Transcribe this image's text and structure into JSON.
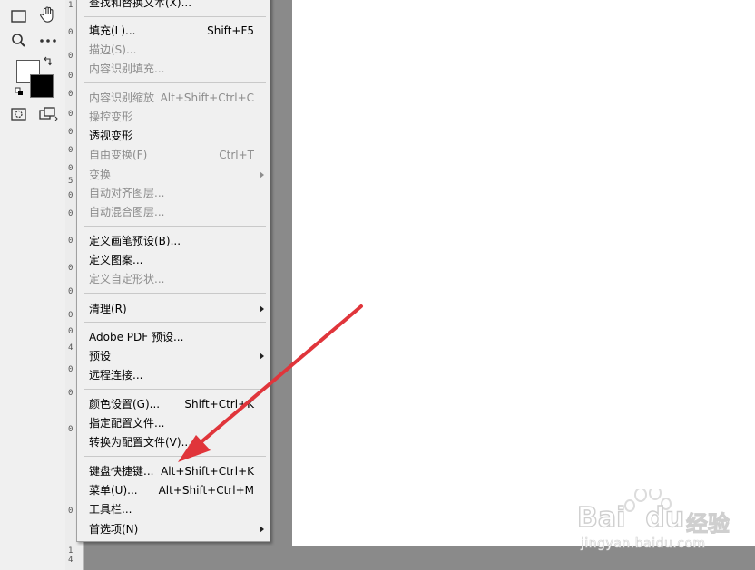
{
  "menu": {
    "items": [
      {
        "label": "查找和替换文本(X)...",
        "shortcut": "",
        "disabled": false,
        "submenu": false
      },
      {
        "label": "填充(L)...",
        "shortcut": "Shift+F5",
        "disabled": false,
        "submenu": false
      },
      {
        "label": "描边(S)...",
        "shortcut": "",
        "disabled": true,
        "submenu": false
      },
      {
        "label": "内容识别填充...",
        "shortcut": "",
        "disabled": true,
        "submenu": false
      },
      {
        "label": "内容识别缩放",
        "shortcut": "Alt+Shift+Ctrl+C",
        "disabled": true,
        "submenu": false
      },
      {
        "label": "操控变形",
        "shortcut": "",
        "disabled": true,
        "submenu": false
      },
      {
        "label": "透视变形",
        "shortcut": "",
        "disabled": false,
        "submenu": false
      },
      {
        "label": "自由变换(F)",
        "shortcut": "Ctrl+T",
        "disabled": true,
        "submenu": false
      },
      {
        "label": "变换",
        "shortcut": "",
        "disabled": true,
        "submenu": true
      },
      {
        "label": "自动对齐图层...",
        "shortcut": "",
        "disabled": true,
        "submenu": false
      },
      {
        "label": "自动混合图层...",
        "shortcut": "",
        "disabled": true,
        "submenu": false
      },
      {
        "label": "定义画笔预设(B)...",
        "shortcut": "",
        "disabled": false,
        "submenu": false
      },
      {
        "label": "定义图案...",
        "shortcut": "",
        "disabled": false,
        "submenu": false
      },
      {
        "label": "定义自定形状...",
        "shortcut": "",
        "disabled": true,
        "submenu": false
      },
      {
        "label": "清理(R)",
        "shortcut": "",
        "disabled": false,
        "submenu": true
      },
      {
        "label": "Adobe PDF 预设...",
        "shortcut": "",
        "disabled": false,
        "submenu": false
      },
      {
        "label": "预设",
        "shortcut": "",
        "disabled": false,
        "submenu": true
      },
      {
        "label": "远程连接...",
        "shortcut": "",
        "disabled": false,
        "submenu": false
      },
      {
        "label": "颜色设置(G)...",
        "shortcut": "Shift+Ctrl+K",
        "disabled": false,
        "submenu": false
      },
      {
        "label": "指定配置文件...",
        "shortcut": "",
        "disabled": false,
        "submenu": false
      },
      {
        "label": "转换为配置文件(V)...",
        "shortcut": "",
        "disabled": false,
        "submenu": false
      },
      {
        "label": "键盘快捷键...",
        "shortcut": "Alt+Shift+Ctrl+K",
        "disabled": false,
        "submenu": false
      },
      {
        "label": "菜单(U)...",
        "shortcut": "Alt+Shift+Ctrl+M",
        "disabled": false,
        "submenu": false
      },
      {
        "label": "工具栏...",
        "shortcut": "",
        "disabled": false,
        "submenu": false
      },
      {
        "label": "首选项(N)",
        "shortcut": "",
        "disabled": false,
        "submenu": true
      }
    ]
  },
  "ruler": {
    "ticks": [
      "1",
      "0",
      "0",
      "0",
      "0",
      "0",
      "0",
      "0",
      "0",
      "5",
      "0",
      "0",
      "0",
      "0",
      "0",
      "0",
      "0",
      "4",
      "0",
      "0",
      "0",
      "0",
      "1",
      "4"
    ]
  },
  "watermark": {
    "brand": "Bai",
    "brand2": "du",
    "cn": "经验",
    "url": "jingyan.baidu.com"
  },
  "colors": {
    "arrow": "#e0353b",
    "menu_bg": "#f0f0f0",
    "disabled_text": "#8d8d8d",
    "workspace": "#8a8a8a"
  }
}
